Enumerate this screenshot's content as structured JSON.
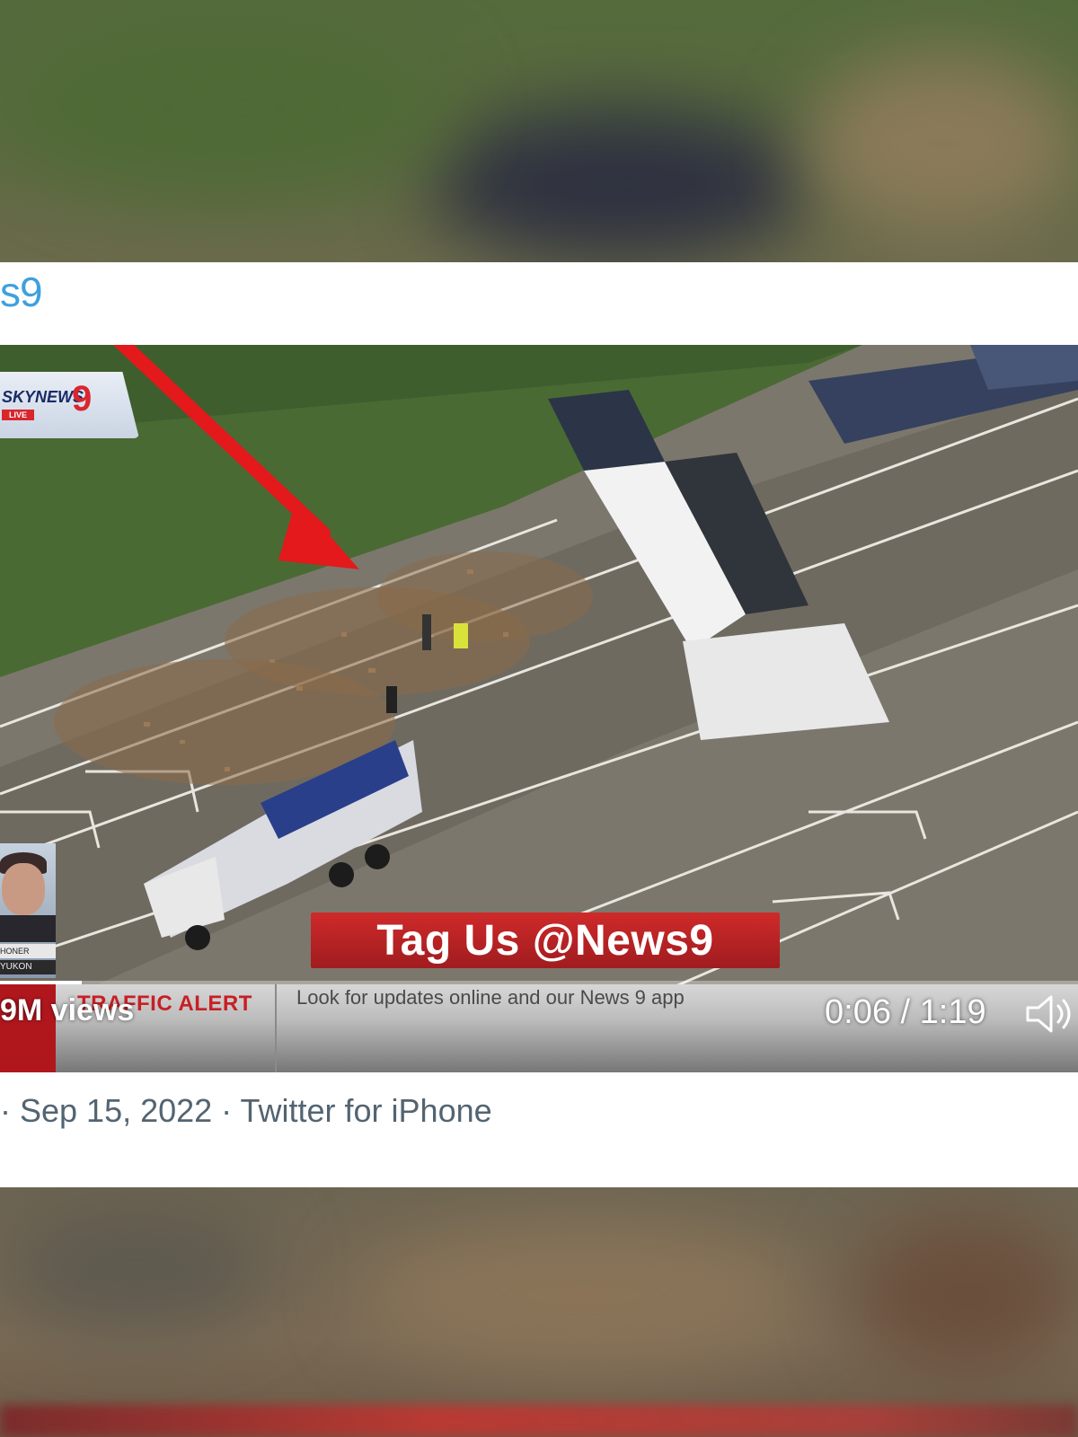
{
  "tweet": {
    "handle_fragment": "s9",
    "meta_line": "· Sep 15, 2022 · Twitter for iPhone"
  },
  "video": {
    "views": "9M views",
    "time": "0:06 / 1:19",
    "progress_fraction": 0.076,
    "overlay": {
      "station_logo": "SKYNEWS",
      "station_number": "9",
      "station_live": "LIVE",
      "banner": "Tag Us @News9",
      "ticker_label": "TRAFFIC ALERT",
      "ticker_text": "Look for updates online and our News 9 app",
      "reporter_name": "HONER",
      "reporter_location": "YUKON"
    }
  },
  "colors": {
    "link_blue": "#3ea0de",
    "news_red": "#c81f24",
    "annotation_arrow": "#e3191c",
    "meta_gray": "#536471"
  }
}
